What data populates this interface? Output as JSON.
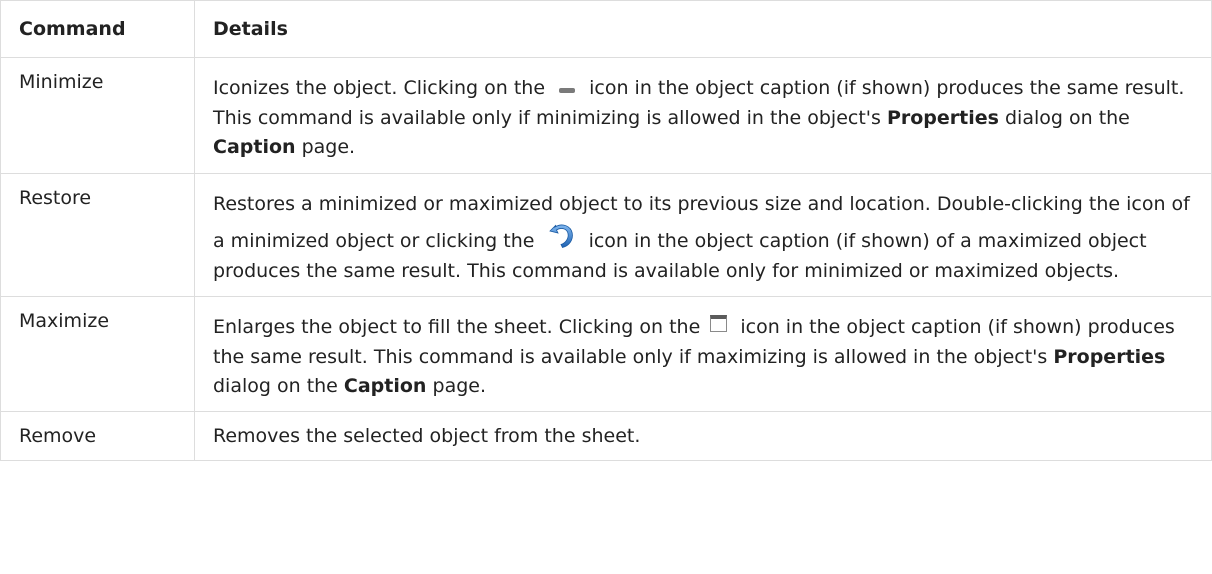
{
  "table": {
    "headers": {
      "command": "Command",
      "details": "Details"
    },
    "rows": [
      {
        "command": "Minimize",
        "icon": "minimize-icon",
        "details": {
          "t1": "Iconizes the object. Clicking on the",
          "t2": "icon in the object caption (if shown) produces the same result. This command is available only if minimizing is allowed in the object's",
          "b1": "Properties",
          "t3": "dialog on the",
          "b2": "Caption",
          "t4": "page."
        }
      },
      {
        "command": "Restore",
        "icon": "restore-icon",
        "details": {
          "t1": "Restores a minimized or maximized object to its previous size and location. Double-clicking the icon of a minimized object or clicking the",
          "t2": "icon in the object caption (if shown) of a maximized object produces the same result. This command is available only for minimized or maximized objects."
        }
      },
      {
        "command": "Maximize",
        "icon": "maximize-icon",
        "details": {
          "t1": "Enlarges the object to fill the sheet. Clicking on the",
          "t2": "icon in the object caption (if shown) produces the same result. This command is available only if maximizing is allowed in the object's",
          "b1": "Properties",
          "t3": "dialog on the",
          "b2": "Caption",
          "t4": "page."
        }
      },
      {
        "command": "Remove",
        "details": {
          "t1": "Removes the selected object from the sheet."
        }
      }
    ]
  },
  "colors": {
    "border": "#dddddd",
    "text": "#222222",
    "restore_icon_blue": "#2d79c7"
  }
}
